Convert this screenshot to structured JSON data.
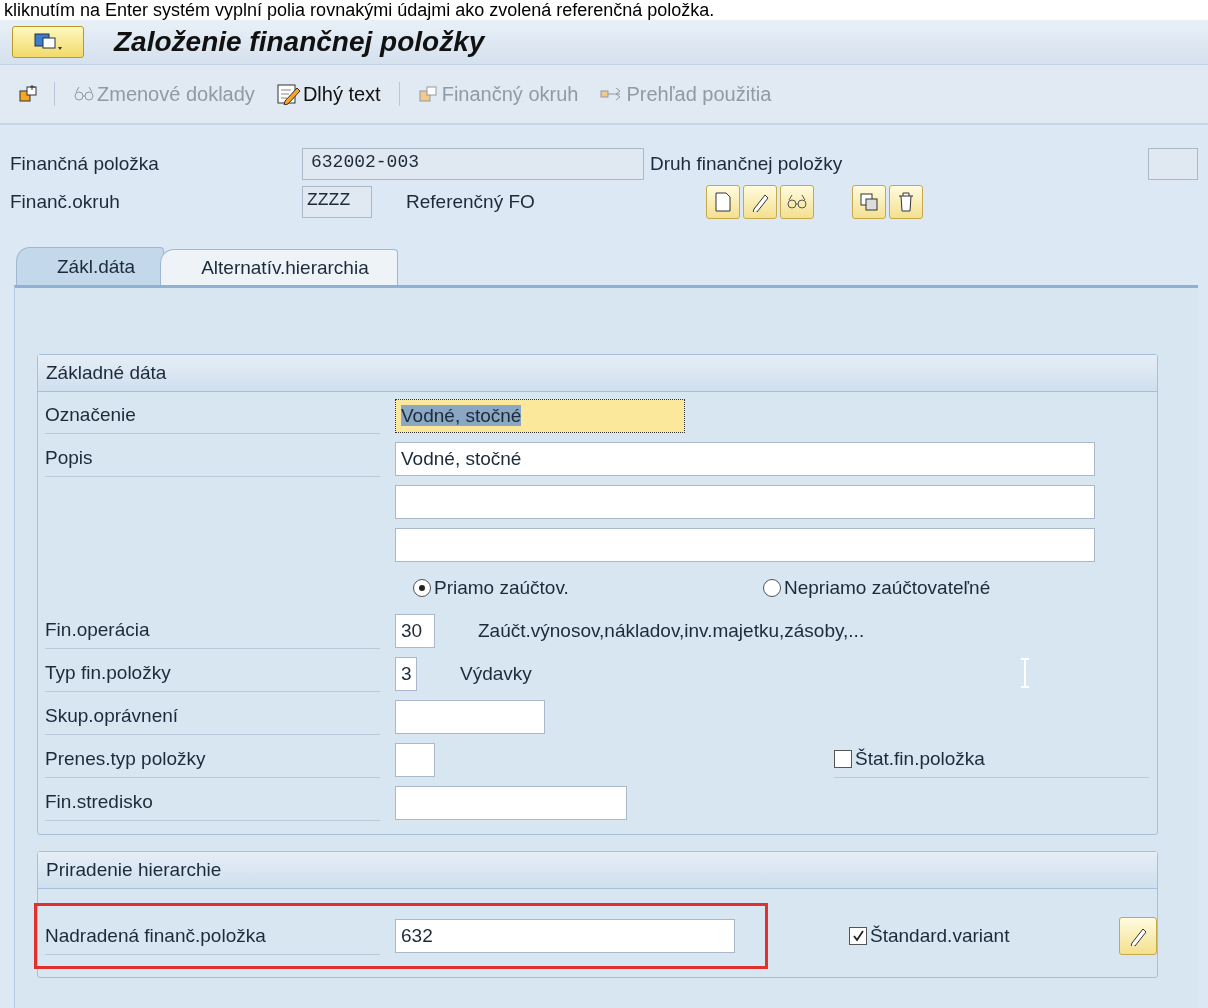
{
  "caption": "kliknutím na Enter systém vyplní polia rovnakými údajmi ako zvolená referenčná položka.",
  "window": {
    "title": "Založenie finančnej položky"
  },
  "toolbar": [
    {
      "label": "Zmenové doklady",
      "disabled": true
    },
    {
      "label": "Dlhý text",
      "disabled": false
    },
    {
      "label": "Finančný okruh",
      "disabled": true
    },
    {
      "label": "Prehľad použitia",
      "disabled": true
    }
  ],
  "header": {
    "item": {
      "label": "Finančná položka",
      "value": "632002-003",
      "readonly": true
    },
    "type": {
      "label": "Druh finančnej položky",
      "readonly": true
    },
    "area": {
      "label": "Finanč.okruh",
      "value": "ZZZZ",
      "readonly": true
    },
    "reference": {
      "label": "Referenčný FO"
    }
  },
  "tabs": [
    {
      "label": "Zákl.dáta",
      "selected": true
    },
    {
      "label": "Alternatív.hierarchia",
      "selected": false
    }
  ],
  "groups": [
    {
      "title": "Základné dáta",
      "rows": [
        {
          "kind": "field",
          "label": "Označenie",
          "value": "Vodné, stočné",
          "focused": true,
          "marked": false
        },
        {
          "kind": "field",
          "label": "Popis",
          "value": "Vodné, stočné",
          "focused": false,
          "marked": false
        },
        {
          "kind": "field",
          "focused": false,
          "marked": false
        },
        {
          "kind": "field",
          "focused": false,
          "marked": false
        },
        {
          "kind": "radios",
          "options": [
            {
              "label": "Priamo zaúčtov.",
              "selected": true
            },
            {
              "label": "Nepriamo zaúčtovateľné",
              "selected": false
            }
          ]
        },
        {
          "kind": "field",
          "label": "Fin.operácia",
          "value": "30",
          "description": "Zaúčt.výnosov,nákladov,inv.majetku,zásoby,...",
          "focused": false,
          "marked": false
        },
        {
          "kind": "field",
          "label": "Typ fin.položky",
          "value": "3",
          "description": "Výdavky",
          "focused": false,
          "marked": false
        },
        {
          "kind": "field",
          "label": "Skup.oprávnení",
          "focused": false,
          "marked": false
        },
        {
          "kind": "field",
          "label": "Prenes.typ položky",
          "checkbox": {
            "label": "Štat.fin.položka",
            "checked": false
          },
          "focused": false,
          "marked": false
        },
        {
          "kind": "field",
          "label": "Fin.stredisko",
          "focused": false,
          "marked": false
        }
      ]
    },
    {
      "title": "Priradenie hierarchie",
      "rows": [
        {
          "kind": "field",
          "label": "Nadradená finanč.položka",
          "value": "632",
          "checkbox": {
            "label": "Štandard.variant",
            "checked": true
          },
          "edit_button": true,
          "focused": false,
          "marked": true
        }
      ]
    }
  ]
}
